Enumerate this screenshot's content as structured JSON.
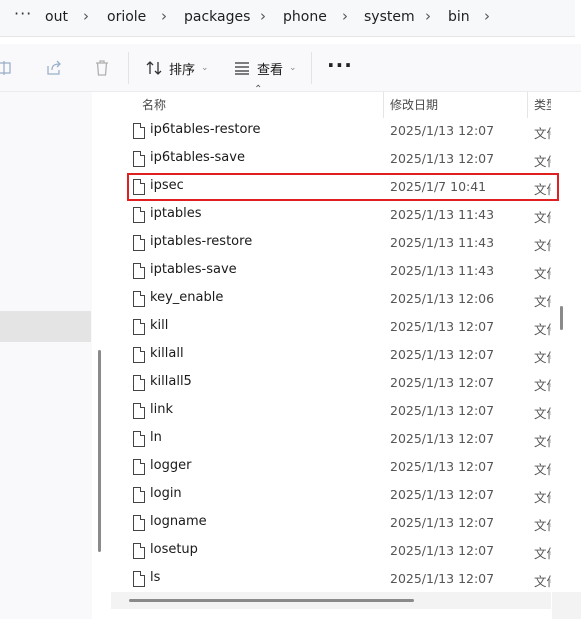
{
  "breadcrumb": {
    "more": "···",
    "items": [
      "out",
      "oriole",
      "packages",
      "phone",
      "system",
      "bin"
    ],
    "separator": "›"
  },
  "toolbar": {
    "sort_label": "排序",
    "view_label": "查看",
    "more_label": "···",
    "icons": [
      "rename-icon",
      "share-icon",
      "delete-icon",
      "sort-icon",
      "view-icon"
    ]
  },
  "columns": {
    "name": "名称",
    "modified": "修改日期",
    "type": "类型"
  },
  "files": [
    {
      "name": "ip6tables-restore",
      "date": "2025/1/13 12:07",
      "type": "文件"
    },
    {
      "name": "ip6tables-save",
      "date": "2025/1/13 12:07",
      "type": "文件"
    },
    {
      "name": "ipsec",
      "date": "2025/1/7 10:41",
      "type": "文件"
    },
    {
      "name": "iptables",
      "date": "2025/1/13 11:43",
      "type": "文件"
    },
    {
      "name": "iptables-restore",
      "date": "2025/1/13 11:43",
      "type": "文件"
    },
    {
      "name": "iptables-save",
      "date": "2025/1/13 11:43",
      "type": "文件"
    },
    {
      "name": "key_enable",
      "date": "2025/1/13 12:06",
      "type": "文件"
    },
    {
      "name": "kill",
      "date": "2025/1/13 12:07",
      "type": "文件"
    },
    {
      "name": "killall",
      "date": "2025/1/13 12:07",
      "type": "文件"
    },
    {
      "name": "killall5",
      "date": "2025/1/13 12:07",
      "type": "文件"
    },
    {
      "name": "link",
      "date": "2025/1/13 12:07",
      "type": "文件"
    },
    {
      "name": "ln",
      "date": "2025/1/13 12:07",
      "type": "文件"
    },
    {
      "name": "logger",
      "date": "2025/1/13 12:07",
      "type": "文件"
    },
    {
      "name": "login",
      "date": "2025/1/13 12:07",
      "type": "文件"
    },
    {
      "name": "logname",
      "date": "2025/1/13 12:07",
      "type": "文件"
    },
    {
      "name": "losetup",
      "date": "2025/1/13 12:07",
      "type": "文件"
    },
    {
      "name": "ls",
      "date": "2025/1/13 12:07",
      "type": "文件"
    }
  ],
  "highlighted_file": "ipsec",
  "colors": {
    "highlight": "#e02020",
    "nav_selected": "#e4e4e4"
  }
}
